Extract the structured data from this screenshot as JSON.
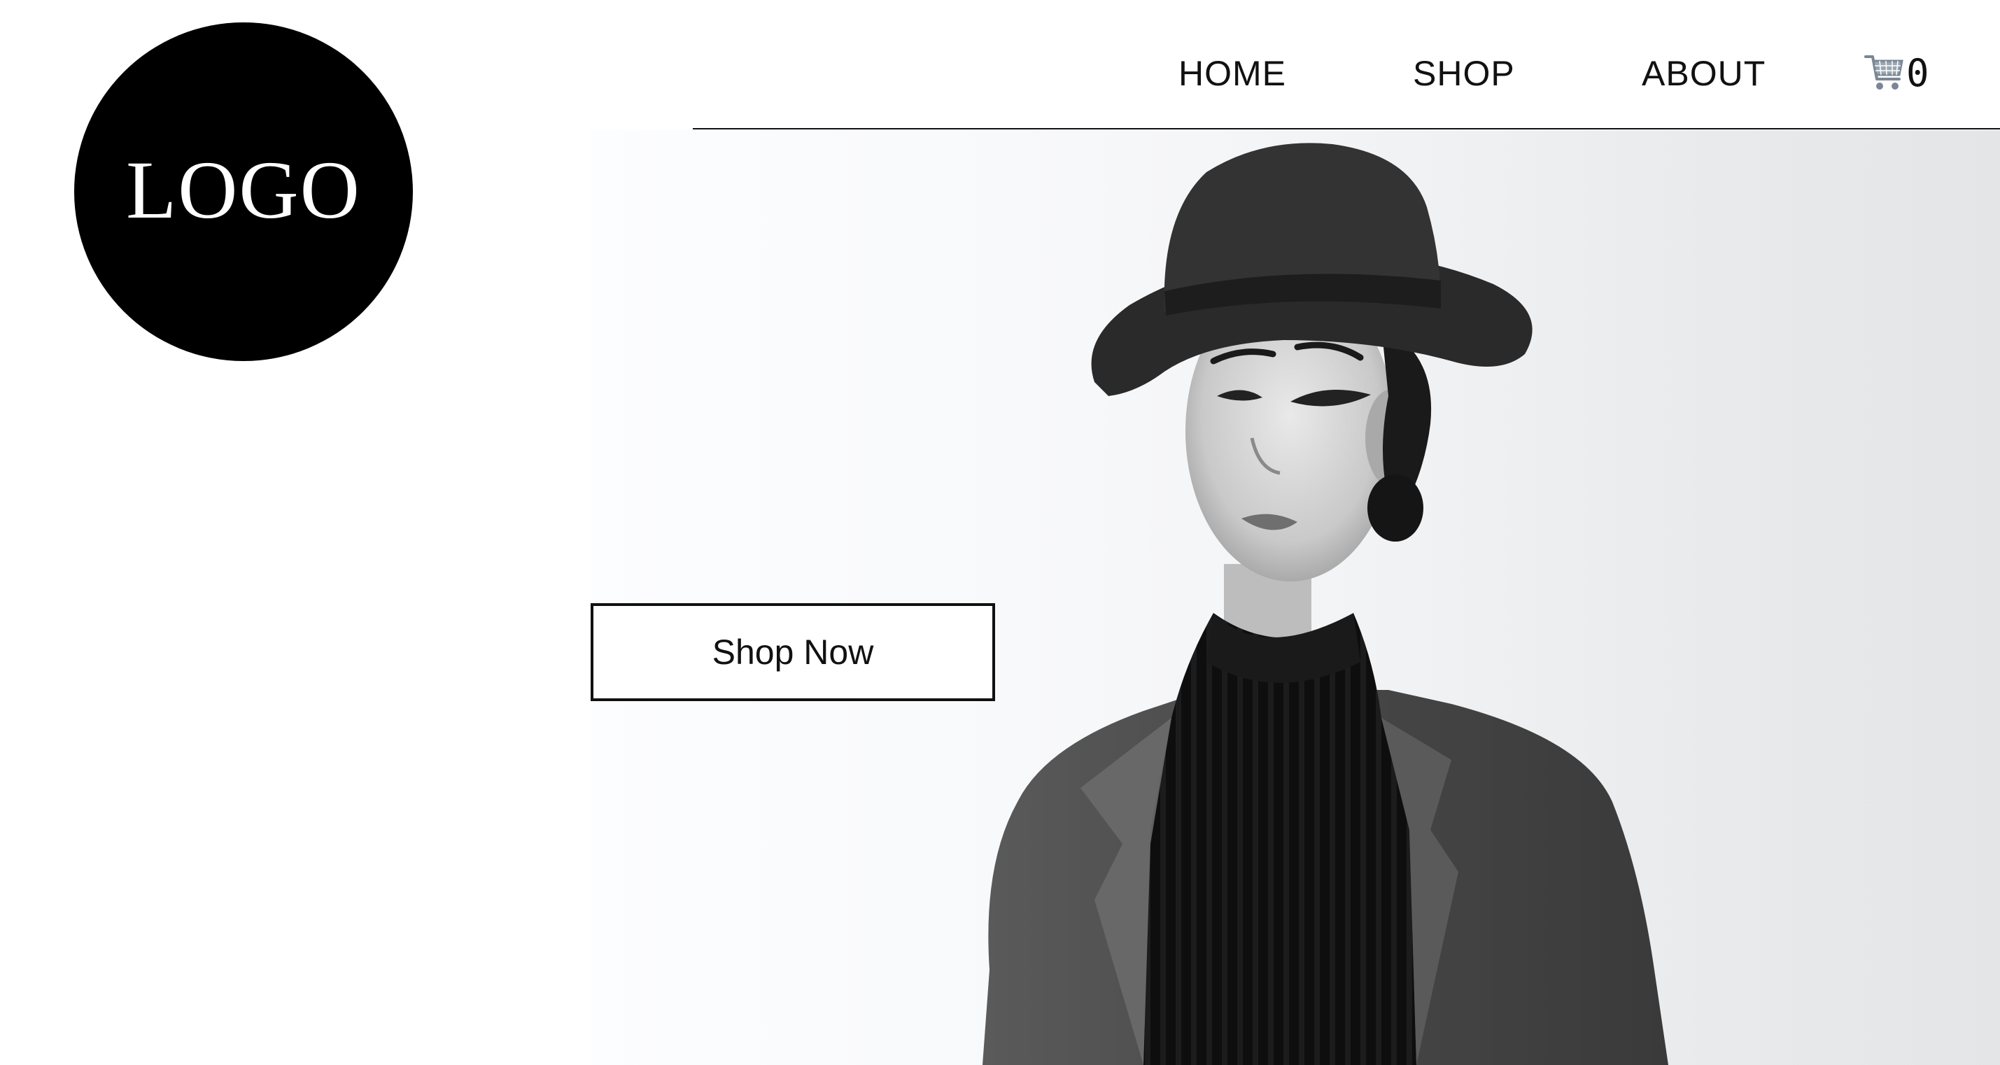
{
  "logo": {
    "text": "LOGO"
  },
  "nav": {
    "items": [
      {
        "label": "HOME"
      },
      {
        "label": "SHOP"
      },
      {
        "label": "ABOUT"
      }
    ],
    "cart": {
      "icon": "shopping-cart-icon",
      "count": "0"
    }
  },
  "hero": {
    "button_label": "Shop Now",
    "image": "black-and-white portrait photo"
  },
  "colors": {
    "text": "#111111",
    "logo_bg": "#000000",
    "logo_text": "#ffffff",
    "cart_icon": "#7a8794"
  }
}
